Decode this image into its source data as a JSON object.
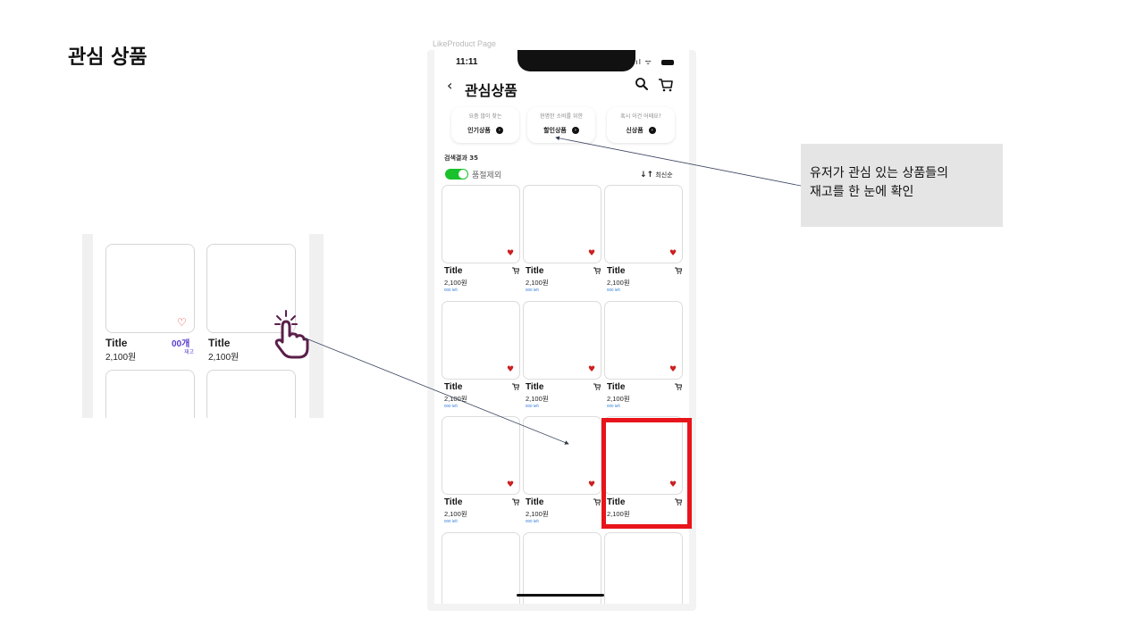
{
  "slide": {
    "title": "관심 상품",
    "callout_line1": "유저가 관심 있는 상품들의",
    "callout_line2": "재고를 한 눈에 확인"
  },
  "zoom": {
    "cards": [
      {
        "name": "Title",
        "price": "2,100원",
        "stock": "00개",
        "stock_sub": "재고",
        "heart": "♡"
      },
      {
        "name": "Title",
        "price": "2,100원"
      }
    ]
  },
  "phone": {
    "label": "LikeProduct Page",
    "time": "11:11",
    "signal": ".ıl ᯤ",
    "back_icon": "‹",
    "title": "관심상품",
    "search_icon": "⚲",
    "cart_icon": "🛒",
    "chips": [
      {
        "sub": "요즘 많이 찾는",
        "main": "인기상품",
        "arrow": "›"
      },
      {
        "sub": "현명한 소비를 위한",
        "main": "할인상품",
        "arrow": "›"
      },
      {
        "sub": "혹시 이건 어때요?",
        "main": "신상품",
        "arrow": "›"
      }
    ],
    "result_label": "검색결과 35",
    "toggle_label": "품절제외",
    "toggle_on": true,
    "sort_label": "최신순",
    "sort_icon": "↓↑",
    "heart_icon": "♥",
    "cart_small_icon": "🛒",
    "products": [
      {
        "name": "Title",
        "price": "2,100원",
        "stock": "000 left"
      },
      {
        "name": "Title",
        "price": "2,100원",
        "stock": "000 left"
      },
      {
        "name": "Title",
        "price": "2,100원",
        "stock": "000 left"
      },
      {
        "name": "Title",
        "price": "2,100원",
        "stock": "000 left"
      },
      {
        "name": "Title",
        "price": "2,100원",
        "stock": "000 left"
      },
      {
        "name": "Title",
        "price": "2,100원",
        "stock": "000 left"
      },
      {
        "name": "Title",
        "price": "2,100원",
        "stock": "000 left"
      },
      {
        "name": "Title",
        "price": "2,100원",
        "stock": "000 left"
      },
      {
        "name": "Title",
        "price": "2,100원"
      }
    ]
  },
  "colors": {
    "highlight": "#e8141b",
    "heart": "#cc1f1f",
    "toggle": "#19c22b",
    "stock_link": "#2f7bd9",
    "stock_purple": "#5b3fd1",
    "callout_bg": "#e5e5e5"
  }
}
